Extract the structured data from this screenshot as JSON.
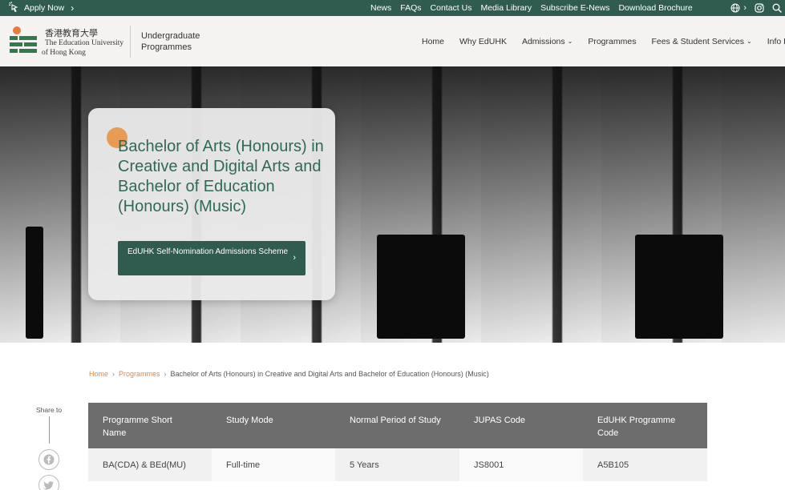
{
  "topbar": {
    "apply_label": "Apply Now",
    "links": [
      "News",
      "FAQs",
      "Contact Us",
      "Media Library",
      "Subscribe E-News",
      "Download Brochure"
    ],
    "icons": [
      "globe-icon",
      "instagram-icon",
      "search-icon"
    ]
  },
  "header": {
    "logo_line1": "香港教育大學",
    "logo_line2": "The Education University",
    "logo_line3": "of Hong Kong",
    "site_name": "Undergraduate Programmes",
    "nav": [
      {
        "label": "Home",
        "has_menu": false
      },
      {
        "label": "Why EdUHK",
        "has_menu": false
      },
      {
        "label": "Admissions",
        "has_menu": true
      },
      {
        "label": "Programmes",
        "has_menu": false
      },
      {
        "label": "Fees & Student Services",
        "has_menu": true
      },
      {
        "label": "Info Day",
        "has_menu": false
      }
    ]
  },
  "hero": {
    "title": "Bachelor of Arts (Honours) in Creative and Digital Arts and Bachelor of Education (Honours) (Music)",
    "button_label": "EdUHK Self-Nomination Admissions Scheme"
  },
  "breadcrumb": {
    "home": "Home",
    "programmes": "Programmes",
    "current": "Bachelor of Arts (Honours) in Creative and Digital Arts and Bachelor of Education (Honours) (Music)"
  },
  "share": {
    "label": "Share to",
    "networks": [
      "facebook-icon",
      "twitter-icon"
    ]
  },
  "programme_table": {
    "headers": [
      "Programme Short Name",
      "Study Mode",
      "Normal Period of Study",
      "JUPAS Code",
      "EdUHK Programme Code"
    ],
    "rows": [
      [
        "BA(CDA) & BEd(MU)",
        "Full-time",
        "5 Years",
        "JS8001",
        "A5B105"
      ]
    ]
  },
  "colors": {
    "brand_green": "#2f5c4f",
    "title_green": "#2f6a56",
    "accent_orange": "#e89b54",
    "table_header": "#6d6d6d"
  }
}
